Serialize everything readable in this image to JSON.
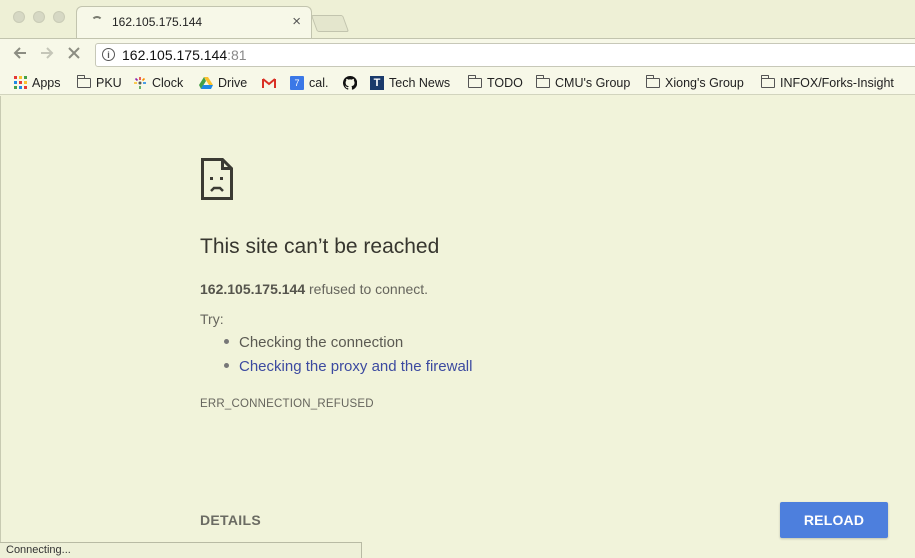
{
  "tab": {
    "title": "162.105.175.144",
    "close": "×"
  },
  "omnibox": {
    "host": "162.105.175.144",
    "port": ":81"
  },
  "bookmarks": [
    {
      "label": "Apps",
      "icon": "apps-grid-icon"
    },
    {
      "label": "PKU",
      "icon": "folder-icon"
    },
    {
      "label": "Clock",
      "icon": "clock-icon"
    },
    {
      "label": "Drive",
      "icon": "drive-icon"
    },
    {
      "label": "",
      "icon": "gmail-icon"
    },
    {
      "label": "cal.",
      "icon": "calendar-icon",
      "badge": "7"
    },
    {
      "label": "",
      "icon": "github-icon"
    },
    {
      "label": "Tech News",
      "icon": "technews-icon",
      "badge": "T"
    },
    {
      "label": "TODO",
      "icon": "folder-icon"
    },
    {
      "label": "CMU's Group",
      "icon": "folder-icon"
    },
    {
      "label": "Xiong's Group",
      "icon": "folder-icon"
    },
    {
      "label": "INFOX/Forks-Insight",
      "icon": "folder-icon"
    }
  ],
  "error": {
    "heading": "This site can’t be reached",
    "host": "162.105.175.144",
    "message": " refused to connect.",
    "try_label": "Try:",
    "suggestions": [
      "Checking the connection",
      "Checking the proxy and the firewall"
    ],
    "code": "ERR_CONNECTION_REFUSED",
    "details_label": "DETAILS",
    "reload_label": "RELOAD"
  },
  "status": {
    "text": "Connecting..."
  },
  "colors": {
    "page_bg": "#f1f3da",
    "reload_button": "#4d7fdd",
    "link": "#3c4aa0"
  }
}
